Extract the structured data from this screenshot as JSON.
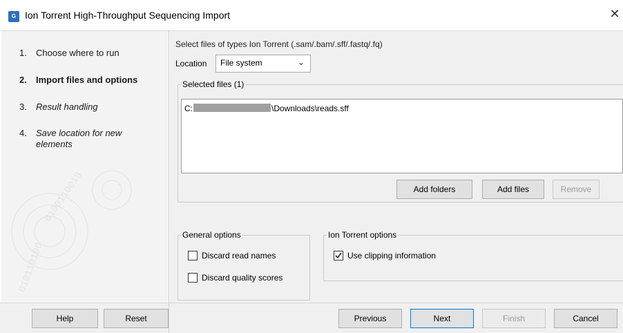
{
  "window": {
    "title": "Ion Torrent High-Throughput Sequencing Import",
    "app_icon_glyph": "G",
    "close_glyph": "✕"
  },
  "steps": [
    {
      "num": "1.",
      "label": "Choose where to run",
      "style": "normal"
    },
    {
      "num": "2.",
      "label": "Import files and options",
      "style": "bold"
    },
    {
      "num": "3.",
      "label": "Result handling",
      "style": "italic"
    },
    {
      "num": "4.",
      "label": "Save location for new elements",
      "style": "italic"
    }
  ],
  "content": {
    "hint": "Select files of types Ion Torrent (.sam/.bam/.sff/.fastq/.fq)",
    "location_label": "Location",
    "location_value": "File system",
    "selected_files_legend": "Selected files (1)",
    "file_prefix": "C:",
    "file_suffix": "\\Downloads\\reads.sff",
    "add_folders": "Add folders",
    "add_files": "Add files",
    "remove": "Remove"
  },
  "general_options": {
    "legend": "General options",
    "discard_read_names": "Discard read names",
    "discard_read_names_checked": false,
    "discard_quality_scores": "Discard quality scores",
    "discard_quality_scores_checked": false
  },
  "ion_options": {
    "legend": "Ion Torrent options",
    "use_clipping": "Use clipping information",
    "use_clipping_checked": true
  },
  "footer": {
    "help": "Help",
    "reset": "Reset",
    "previous": "Previous",
    "next": "Next",
    "finish": "Finish",
    "cancel": "Cancel"
  },
  "colors": {
    "accent": "#0078d7",
    "icon": "#2f6fbf"
  }
}
